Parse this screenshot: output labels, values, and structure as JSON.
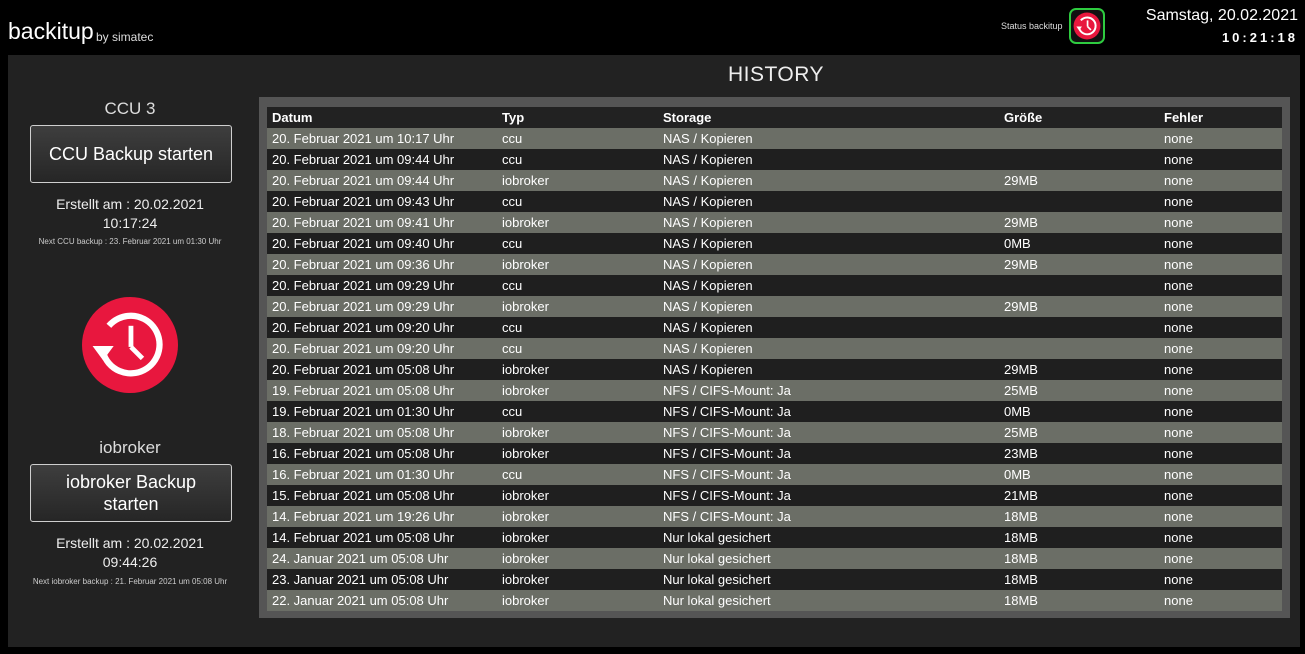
{
  "header": {
    "app_title": "backitup",
    "app_subtitle": "by simatec",
    "status_label": "Status backitup",
    "status_icon": "history-restore-icon",
    "status_color": "#2ecc40",
    "date": "Samstag, 20.02.2021",
    "time": "10:21:18"
  },
  "ccu": {
    "title": "CCU 3",
    "button_label": "CCU Backup starten",
    "created": "Erstellt am : 20.02.2021",
    "created_time": "10:17:24",
    "next": "Next CCU backup : 23. Februar 2021 um 01:30 Uhr"
  },
  "center_icon": {
    "name": "history-restore-icon",
    "color": "#e8173e"
  },
  "iobroker": {
    "title": "iobroker",
    "button_label": "iobroker Backup starten",
    "created": "Erstellt am : 20.02.2021",
    "created_time": "09:44:26",
    "next": "Next iobroker backup : 21. Februar 2021 um 05:08 Uhr"
  },
  "history": {
    "title": "HISTORY",
    "columns": [
      "Datum",
      "Typ",
      "Storage",
      "Größe",
      "Fehler"
    ],
    "rows": [
      [
        "20. Februar 2021 um 10:17 Uhr",
        "ccu",
        "NAS / Kopieren",
        "",
        "none"
      ],
      [
        "20. Februar 2021 um 09:44 Uhr",
        "ccu",
        "NAS / Kopieren",
        "",
        "none"
      ],
      [
        "20. Februar 2021 um 09:44 Uhr",
        "iobroker",
        "NAS / Kopieren",
        "29MB",
        "none"
      ],
      [
        "20. Februar 2021 um 09:43 Uhr",
        "ccu",
        "NAS / Kopieren",
        "",
        "none"
      ],
      [
        "20. Februar 2021 um 09:41 Uhr",
        "iobroker",
        "NAS / Kopieren",
        "29MB",
        "none"
      ],
      [
        "20. Februar 2021 um 09:40 Uhr",
        "ccu",
        "NAS / Kopieren",
        "0MB",
        "none"
      ],
      [
        "20. Februar 2021 um 09:36 Uhr",
        "iobroker",
        "NAS / Kopieren",
        "29MB",
        "none"
      ],
      [
        "20. Februar 2021 um 09:29 Uhr",
        "ccu",
        "NAS / Kopieren",
        "",
        "none"
      ],
      [
        "20. Februar 2021 um 09:29 Uhr",
        "iobroker",
        "NAS / Kopieren",
        "29MB",
        "none"
      ],
      [
        "20. Februar 2021 um 09:20 Uhr",
        "ccu",
        "NAS / Kopieren",
        "",
        "none"
      ],
      [
        "20. Februar 2021 um 09:20 Uhr",
        "ccu",
        "NAS / Kopieren",
        "",
        "none"
      ],
      [
        "20. Februar 2021 um 05:08 Uhr",
        "iobroker",
        "NAS / Kopieren",
        "29MB",
        "none"
      ],
      [
        "19. Februar 2021 um 05:08 Uhr",
        "iobroker",
        "NFS / CIFS-Mount: Ja",
        "25MB",
        "none"
      ],
      [
        "19. Februar 2021 um 01:30 Uhr",
        "ccu",
        "NFS / CIFS-Mount: Ja",
        "0MB",
        "none"
      ],
      [
        "18. Februar 2021 um 05:08 Uhr",
        "iobroker",
        "NFS / CIFS-Mount: Ja",
        "25MB",
        "none"
      ],
      [
        "16. Februar 2021 um 05:08 Uhr",
        "iobroker",
        "NFS / CIFS-Mount: Ja",
        "23MB",
        "none"
      ],
      [
        "16. Februar 2021 um 01:30 Uhr",
        "ccu",
        "NFS / CIFS-Mount: Ja",
        "0MB",
        "none"
      ],
      [
        "15. Februar 2021 um 05:08 Uhr",
        "iobroker",
        "NFS / CIFS-Mount: Ja",
        "21MB",
        "none"
      ],
      [
        "14. Februar 2021 um 19:26 Uhr",
        "iobroker",
        "NFS / CIFS-Mount: Ja",
        "18MB",
        "none"
      ],
      [
        "14. Februar 2021 um 05:08 Uhr",
        "iobroker",
        "Nur lokal gesichert",
        "18MB",
        "none"
      ],
      [
        "24. Januar 2021 um 05:08 Uhr",
        "iobroker",
        "Nur lokal gesichert",
        "18MB",
        "none"
      ],
      [
        "23. Januar 2021 um 05:08 Uhr",
        "iobroker",
        "Nur lokal gesichert",
        "18MB",
        "none"
      ],
      [
        "22. Januar 2021 um 05:08 Uhr",
        "iobroker",
        "Nur lokal gesichert",
        "18MB",
        "none"
      ]
    ]
  }
}
